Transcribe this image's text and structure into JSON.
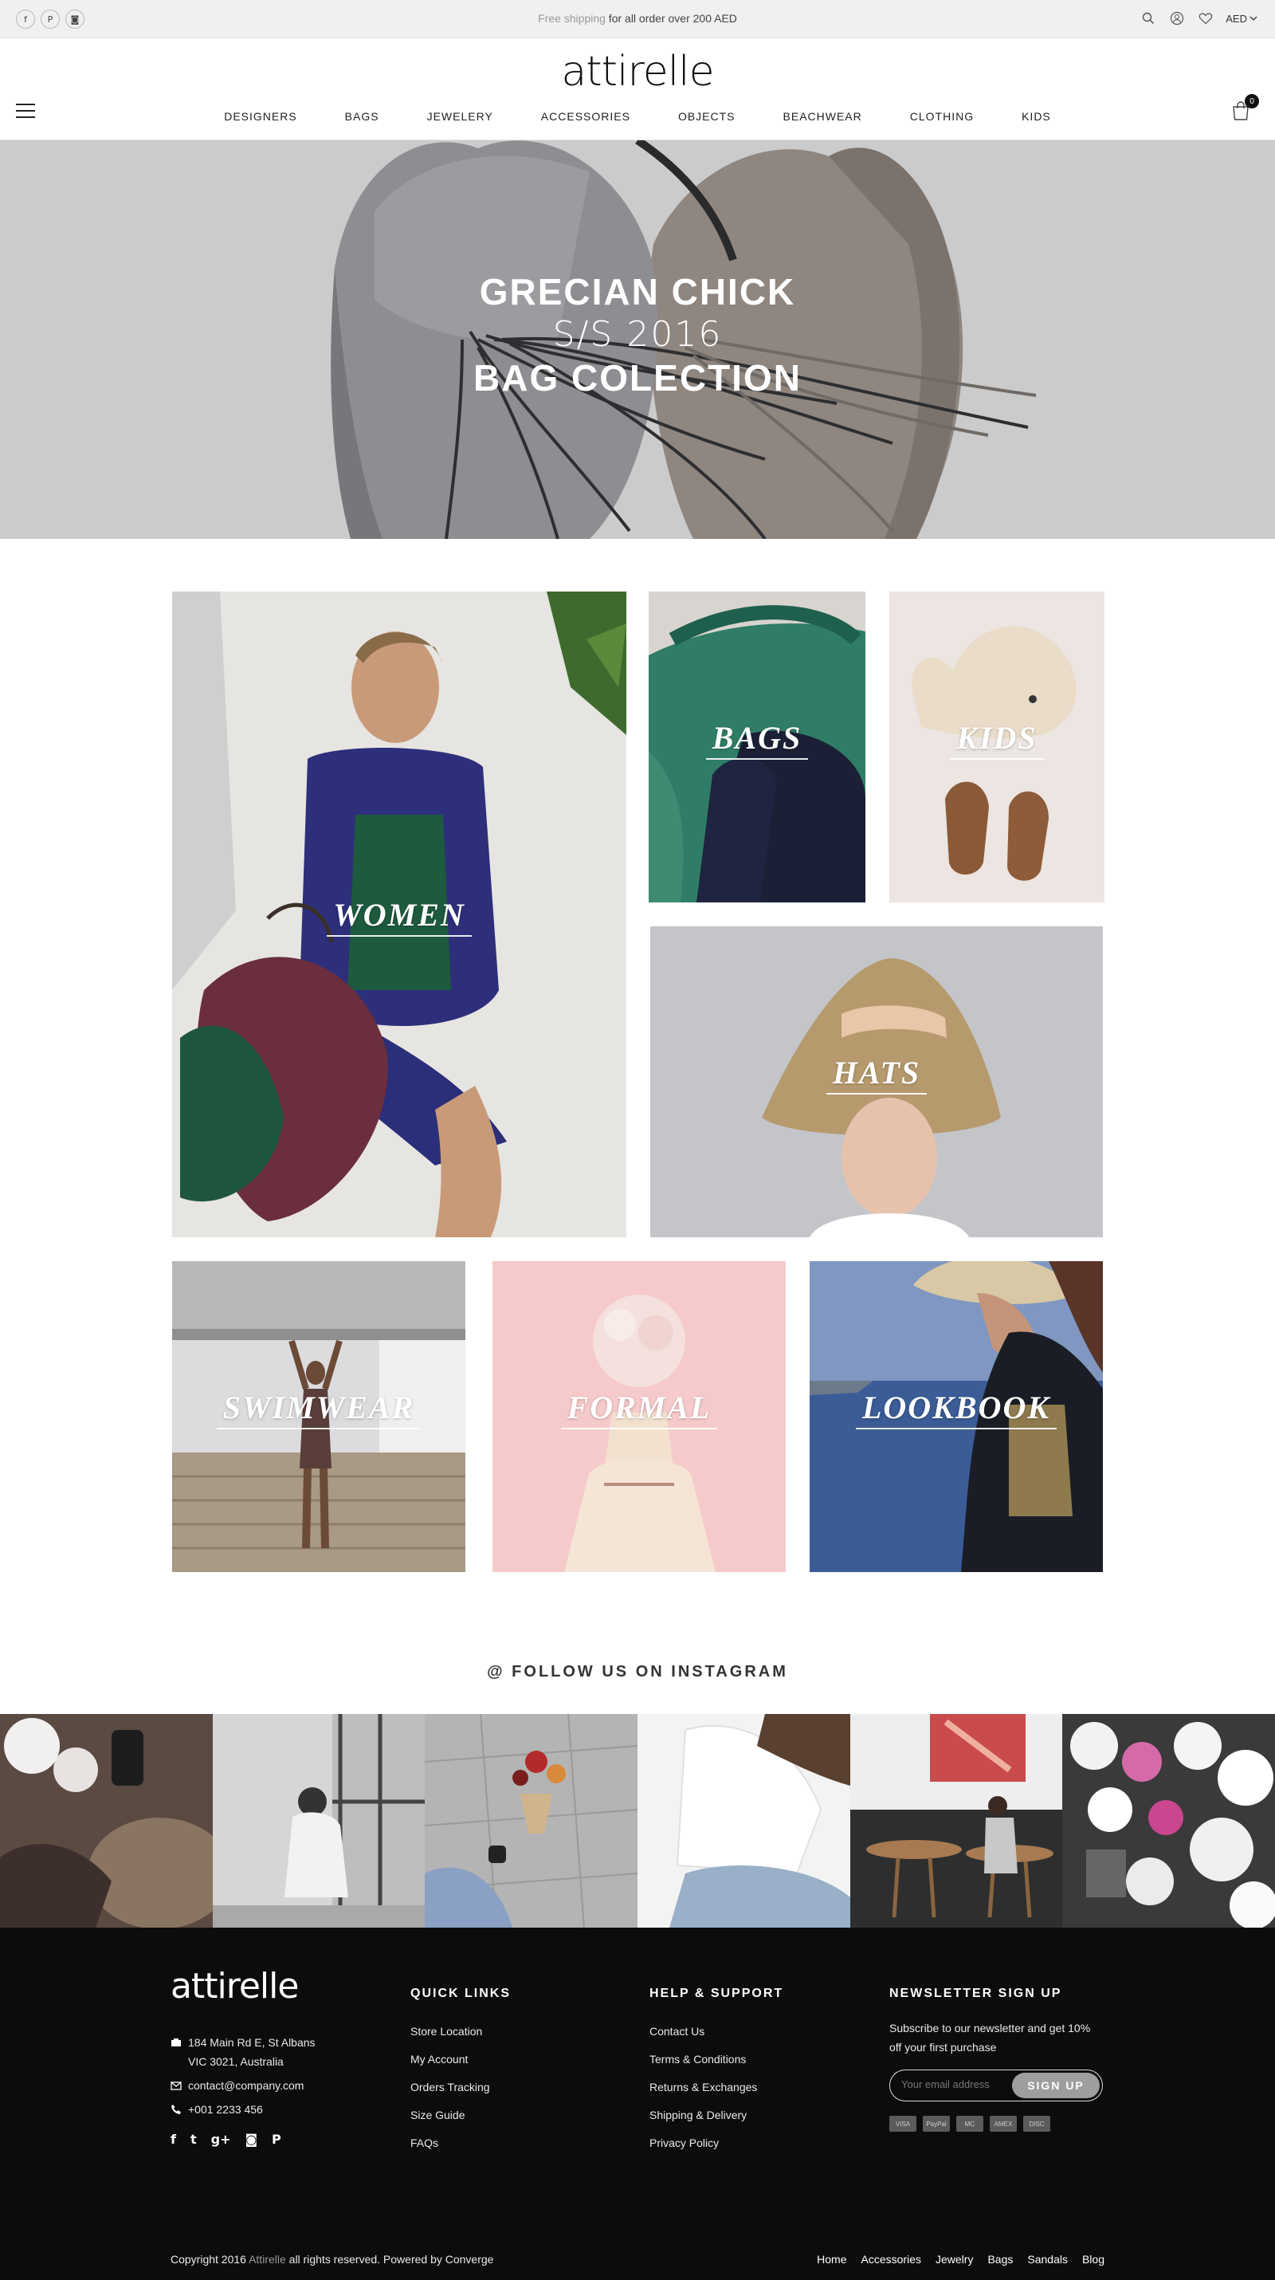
{
  "topbar": {
    "social": [
      {
        "icon": "facebook-icon",
        "glyph": "f"
      },
      {
        "icon": "pinterest-icon",
        "glyph": "P"
      },
      {
        "icon": "instagram-icon",
        "glyph": "◙"
      }
    ],
    "promo_highlight": "Free shipping",
    "promo_text": " for all order over 200 AED",
    "currency": "AED"
  },
  "header": {
    "logo": "attirelle",
    "nav": [
      "DESIGNERS",
      "BAGS",
      "JEWELERY",
      "ACCESSORIES",
      "OBJECTS",
      "BEACHWEAR",
      "CLOTHING",
      "KIDS"
    ],
    "cart_count": "0"
  },
  "hero": {
    "line1": "GRECIAN CHICK",
    "line2": "S/S 2016",
    "line3": "BAG COLECTION"
  },
  "categories": {
    "women": "WOMEN",
    "bags": "BAGS",
    "kids": "KIDS",
    "hats": "HATS",
    "swimwear": "SWIMWEAR",
    "formal": "FORMAL",
    "lookbook": "LOOKBOOK"
  },
  "instagram": {
    "title": "@ FOLLOW US ON INSTAGRAM"
  },
  "footer": {
    "logo": "attirelle",
    "address_line1": "184 Main Rd E, St Albans",
    "address_line2": "VIC 3021, Australia",
    "email": "contact@company.com",
    "phone": "+001 2233 456",
    "social": [
      "f",
      "t",
      "g+",
      "◙",
      "P"
    ],
    "quick_links_title": "QUICK LINKS",
    "quick_links": [
      "Store Location",
      "My Account",
      "Orders Tracking",
      "Size Guide",
      "FAQs"
    ],
    "help_title": "HELP & SUPPORT",
    "help_links": [
      "Contact Us",
      "Terms & Conditions",
      "Returns & Exchanges",
      "Shipping & Delivery",
      "Privacy Policy"
    ],
    "newsletter_title": "NEWSLETTER SIGN UP",
    "newsletter_text": "Subscribe to our newsletter and get 10% off your first purchase",
    "newsletter_placeholder": "Your email address",
    "newsletter_button": "SIGN UP",
    "payment_cards": [
      "VISA",
      "PayPal",
      "MC",
      "AMEX",
      "DISC"
    ],
    "copyright_prefix": "Copyright 2016 ",
    "copyright_brand": "Attirelle",
    "copyright_suffix": " all rights reserved. Powered by Converge",
    "bottom_links": [
      "Home",
      "Accessories",
      "Jewelry",
      "Bags",
      "Sandals",
      "Blog"
    ]
  }
}
